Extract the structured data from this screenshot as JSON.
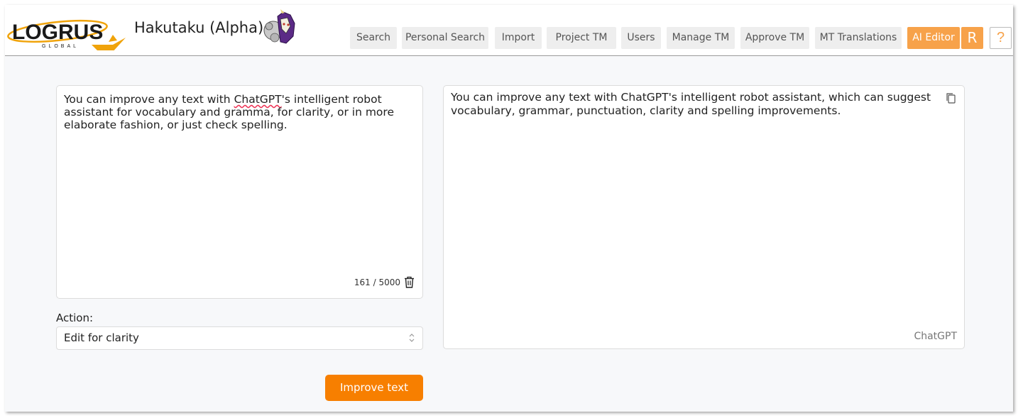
{
  "app": {
    "logo_text": "LOGRUS",
    "logo_sub": "GLOBAL",
    "title": "Hakutaku (Alpha)"
  },
  "nav": {
    "items": [
      {
        "label": "Search"
      },
      {
        "label": "Personal Search"
      },
      {
        "label": "Import"
      },
      {
        "label": "Project TM"
      },
      {
        "label": "Users"
      },
      {
        "label": "Manage TM"
      },
      {
        "label": "Approve TM"
      },
      {
        "label": "MT Translations"
      },
      {
        "label": "AI Editor",
        "active": true
      }
    ],
    "user_initial": "R",
    "help_label": "?"
  },
  "editor": {
    "input_before": "You can improve any text with ",
    "input_flagged": "ChatGPT",
    "input_after": "'s intelligent robot assistant for vocabulary and gramma, for clarity, or in more elaborate fashion, or just check spelling.",
    "counter": "161 / 5000",
    "action_label": "Action:",
    "action_value": "Edit for clarity",
    "submit_label": "Improve text",
    "output_text": "You can improve any text with ChatGPT's intelligent robot assistant, which can suggest vocabulary, grammar, punctuation, clarity and spelling improvements.",
    "provider": "ChatGPT"
  },
  "colors": {
    "accent": "#f7a24a",
    "button": "#f77f00",
    "logo_swoosh": "#f0a30a"
  },
  "icons": [
    "trash-icon",
    "copy-icon",
    "chevron-updown-icon"
  ]
}
